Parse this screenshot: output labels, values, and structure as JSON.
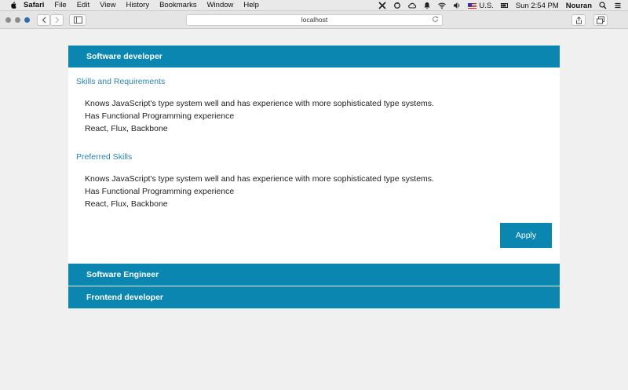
{
  "menubar": {
    "app_name": "Safari",
    "items": [
      "File",
      "Edit",
      "View",
      "History",
      "Bookmarks",
      "Window",
      "Help"
    ],
    "input_source": "U.S.",
    "clock": "Sun 2:54 PM",
    "user": "Nouran"
  },
  "browser": {
    "address": "localhost"
  },
  "jobs": [
    {
      "title": "Software developer",
      "expanded": true,
      "sections": [
        {
          "heading": "Skills and Requirements",
          "items": [
            "Knows JavaScript's type system well and has experience with more sophisticated type systems.",
            "Has Functional Programming experience",
            "React, Flux, Backbone"
          ]
        },
        {
          "heading": "Preferred Skills",
          "items": [
            "Knows JavaScript's type system well and has experience with more sophisticated type systems.",
            "Has Functional Programming experience",
            "React, Flux, Backbone"
          ]
        }
      ],
      "apply_label": "Apply"
    },
    {
      "title": "Software Engineer",
      "expanded": false
    },
    {
      "title": "Frontend developer",
      "expanded": false
    }
  ],
  "colors": {
    "accent": "#0a86b0",
    "section_heading": "#2a85b3",
    "page_background": "#f1f0f1"
  }
}
